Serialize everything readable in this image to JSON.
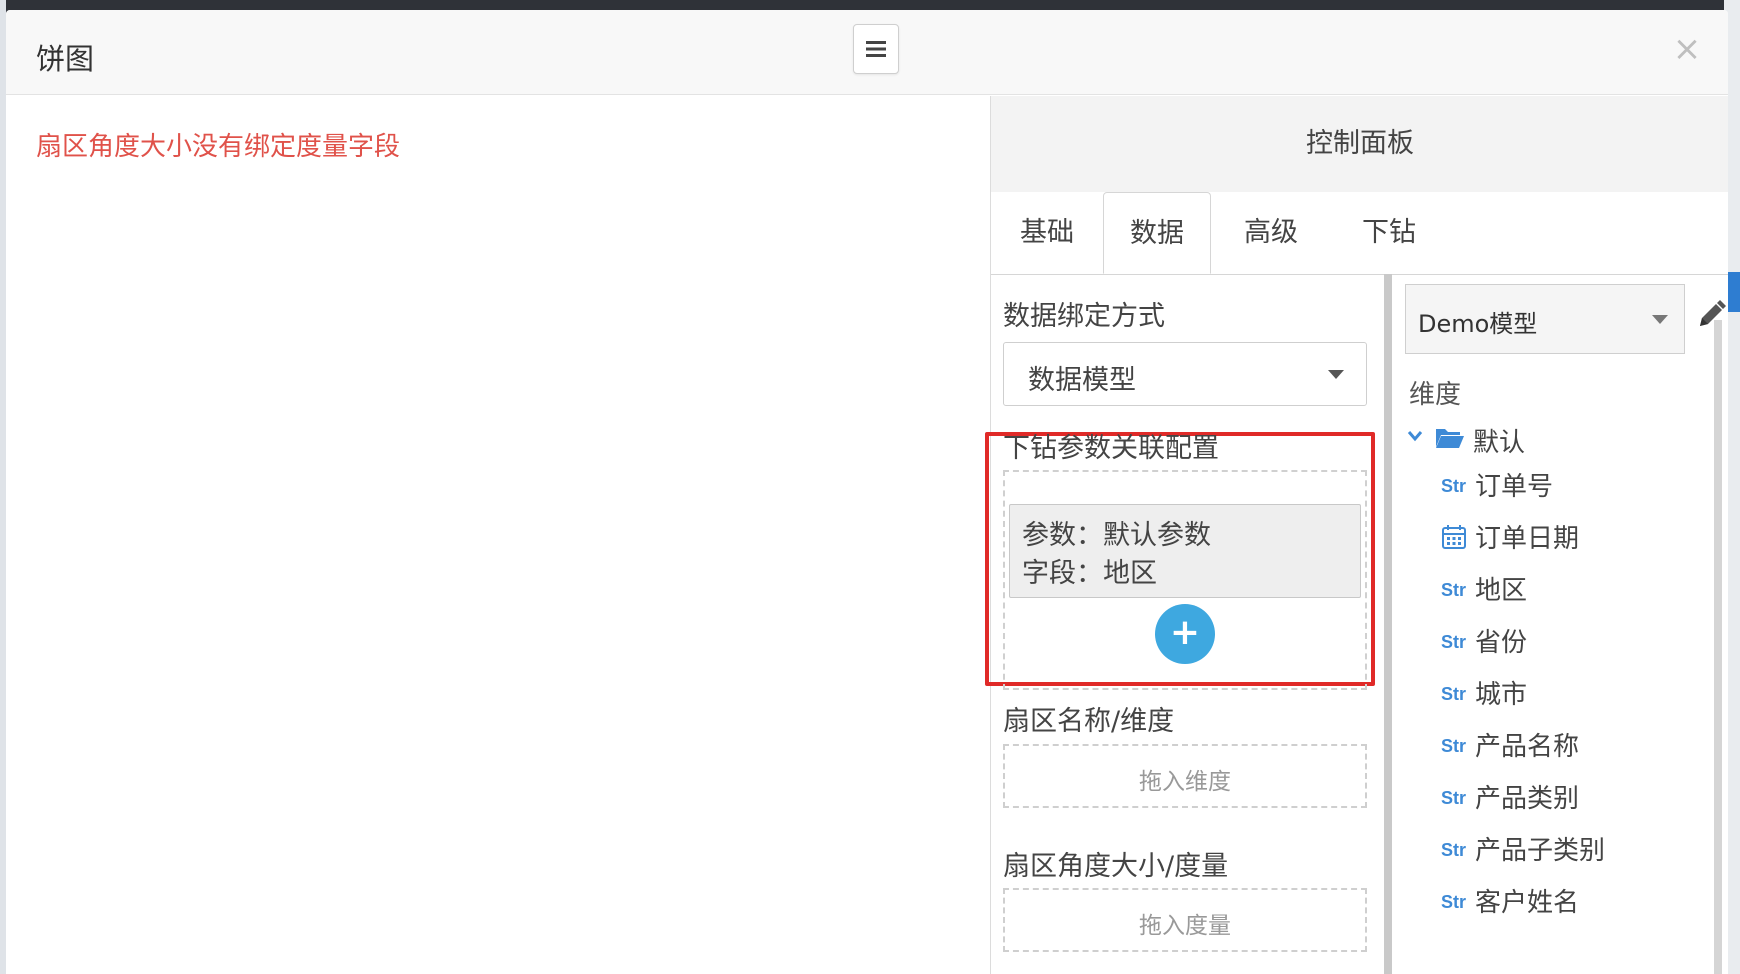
{
  "modal": {
    "title": "饼图",
    "warning": "扇区角度大小没有绑定度量字段"
  },
  "panel": {
    "title": "控制面板",
    "tabs": [
      {
        "label": "基础"
      },
      {
        "label": "数据"
      },
      {
        "label": "高级"
      },
      {
        "label": "下钻"
      }
    ],
    "active_tab": "数据",
    "binding": {
      "label": "数据绑定方式",
      "value": "数据模型"
    },
    "drill": {
      "label": "下钻参数关联配置",
      "param_line": "参数：默认参数",
      "field_line": "字段：地区"
    },
    "sector_name": {
      "label": "扇区名称/维度",
      "placeholder": "拖入维度"
    },
    "sector_angle": {
      "label": "扇区角度大小/度量",
      "placeholder": "拖入度量"
    },
    "model": {
      "value": "Demo模型"
    },
    "dimension": {
      "label": "维度",
      "folder": "默认",
      "fields": [
        {
          "tag": "Str",
          "name": "订单号",
          "icon": "str-tag"
        },
        {
          "tag": "",
          "name": "订单日期",
          "icon": "calendar-icon"
        },
        {
          "tag": "Str",
          "name": "地区",
          "icon": "str-tag"
        },
        {
          "tag": "Str",
          "name": "省份",
          "icon": "str-tag"
        },
        {
          "tag": "Str",
          "name": "城市",
          "icon": "str-tag"
        },
        {
          "tag": "Str",
          "name": "产品名称",
          "icon": "str-tag"
        },
        {
          "tag": "Str",
          "name": "产品类别",
          "icon": "str-tag"
        },
        {
          "tag": "Str",
          "name": "产品子类别",
          "icon": "str-tag"
        },
        {
          "tag": "Str",
          "name": "客户姓名",
          "icon": "str-tag"
        }
      ]
    }
  },
  "colors": {
    "warning": "#e0524a",
    "highlight": "#e02a28",
    "accent": "#3ea8e0",
    "str_tag": "#3e8ad6"
  }
}
